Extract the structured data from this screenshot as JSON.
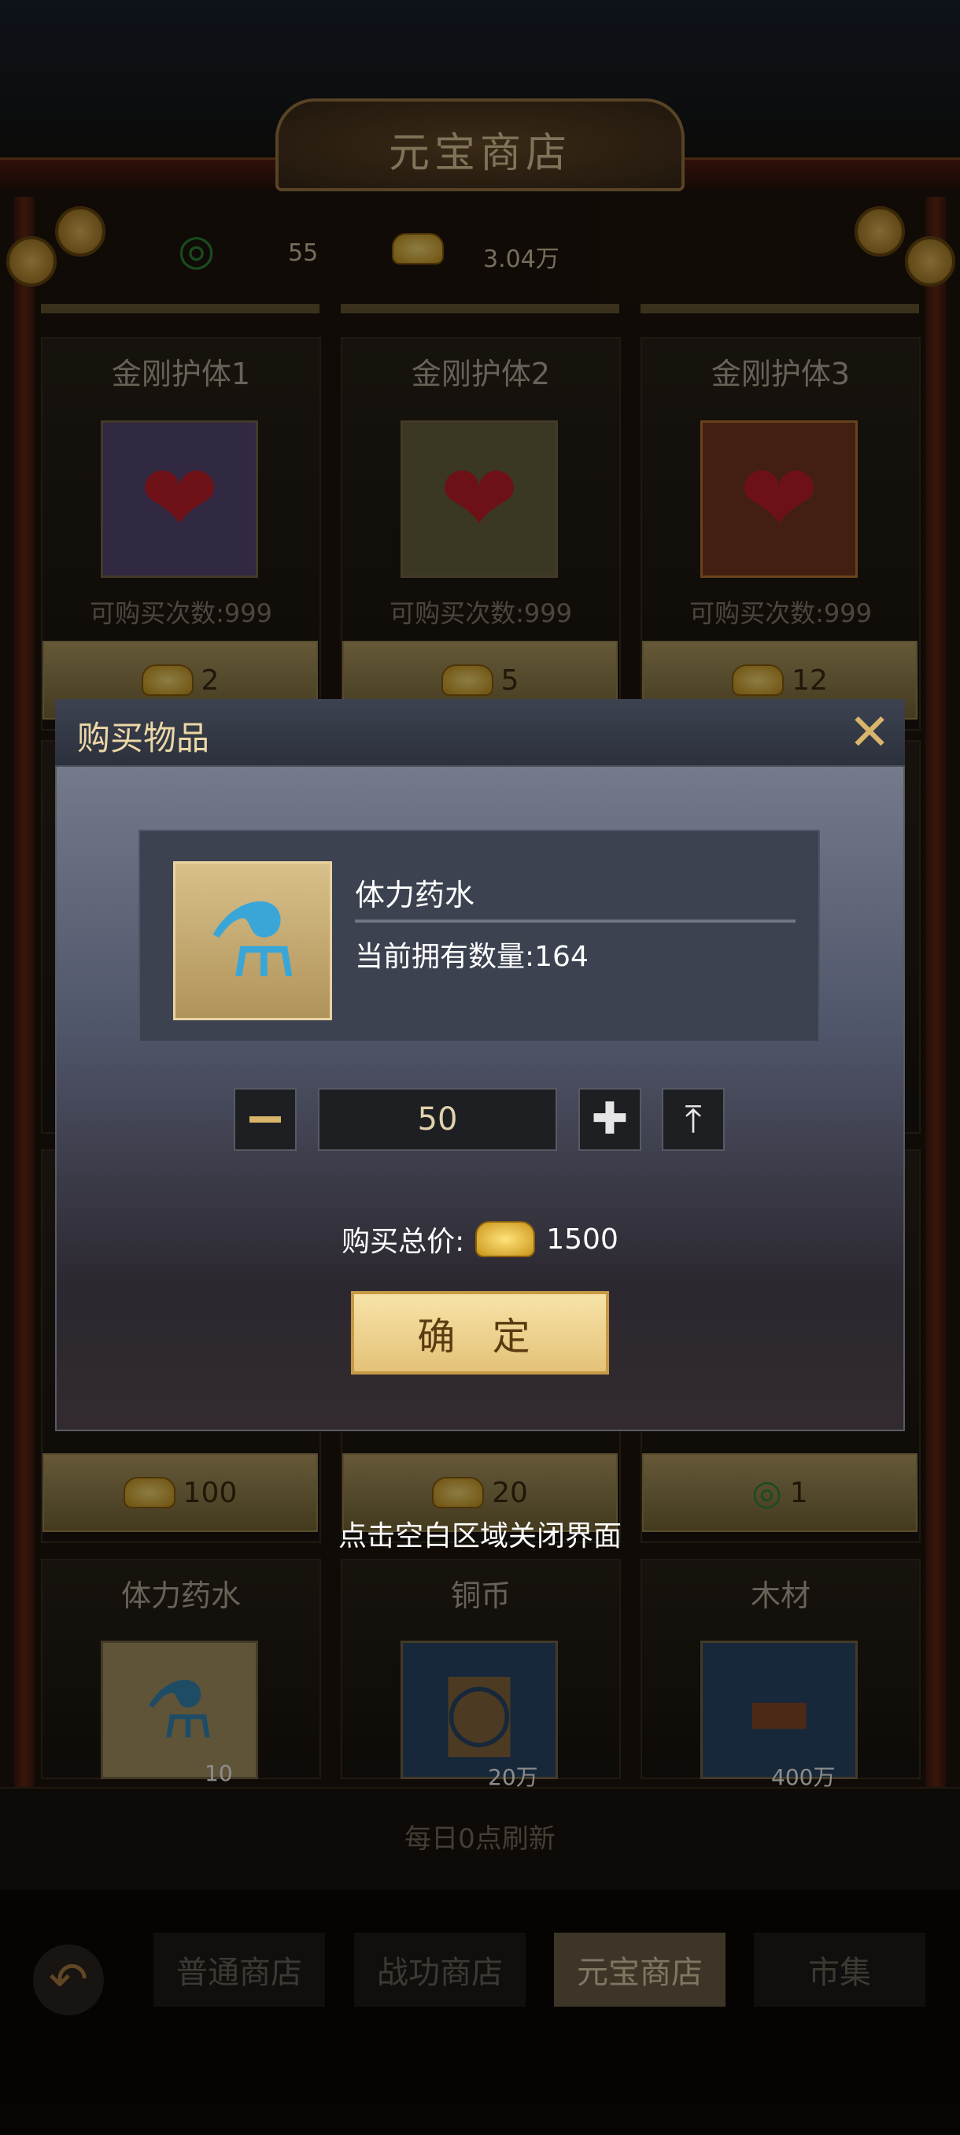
{
  "shop": {
    "title": "元宝商店",
    "currencies": [
      {
        "icon": "jade-ring-icon",
        "value": "55"
      },
      {
        "icon": "gold-ingot-icon",
        "value": "3.04万"
      }
    ],
    "items_row1": [
      {
        "name": "金刚护体1",
        "limit": "可购买次数:999",
        "price": "2",
        "icon": "heart-plus-icon"
      },
      {
        "name": "金刚护体2",
        "limit": "可购买次数:999",
        "price": "5",
        "icon": "heart-plus-icon"
      },
      {
        "name": "金刚护体3",
        "limit": "可购买次数:999",
        "price": "12",
        "icon": "heart-plus-icon"
      }
    ],
    "items_row3_prices": [
      {
        "price": "100",
        "icon": "gold-ingot-icon"
      },
      {
        "price": "20",
        "icon": "gold-ingot-icon"
      },
      {
        "price": "1",
        "icon": "jade-ring-icon"
      }
    ],
    "items_row4": [
      {
        "name": "体力药水",
        "qty": "10"
      },
      {
        "name": "铜币",
        "qty": "20万"
      },
      {
        "name": "木材",
        "qty": "400万"
      }
    ],
    "refresh": "每日0点刷新"
  },
  "tabs": [
    {
      "label": "普通商店",
      "active": false
    },
    {
      "label": "战功商店",
      "active": false
    },
    {
      "label": "元宝商店",
      "active": true
    },
    {
      "label": "市集",
      "active": false
    }
  ],
  "modal": {
    "title": "购买物品",
    "item_name": "体力药水",
    "owned": "当前拥有数量:164",
    "quantity": "50",
    "total_label": "购买总价:",
    "total_value": "1500",
    "confirm": "确 定"
  },
  "hint": "点击空白区域关闭界面",
  "colors": {
    "gold": "#e4c278",
    "accent": "#d8b56a",
    "tab_active": "#6f6248"
  }
}
